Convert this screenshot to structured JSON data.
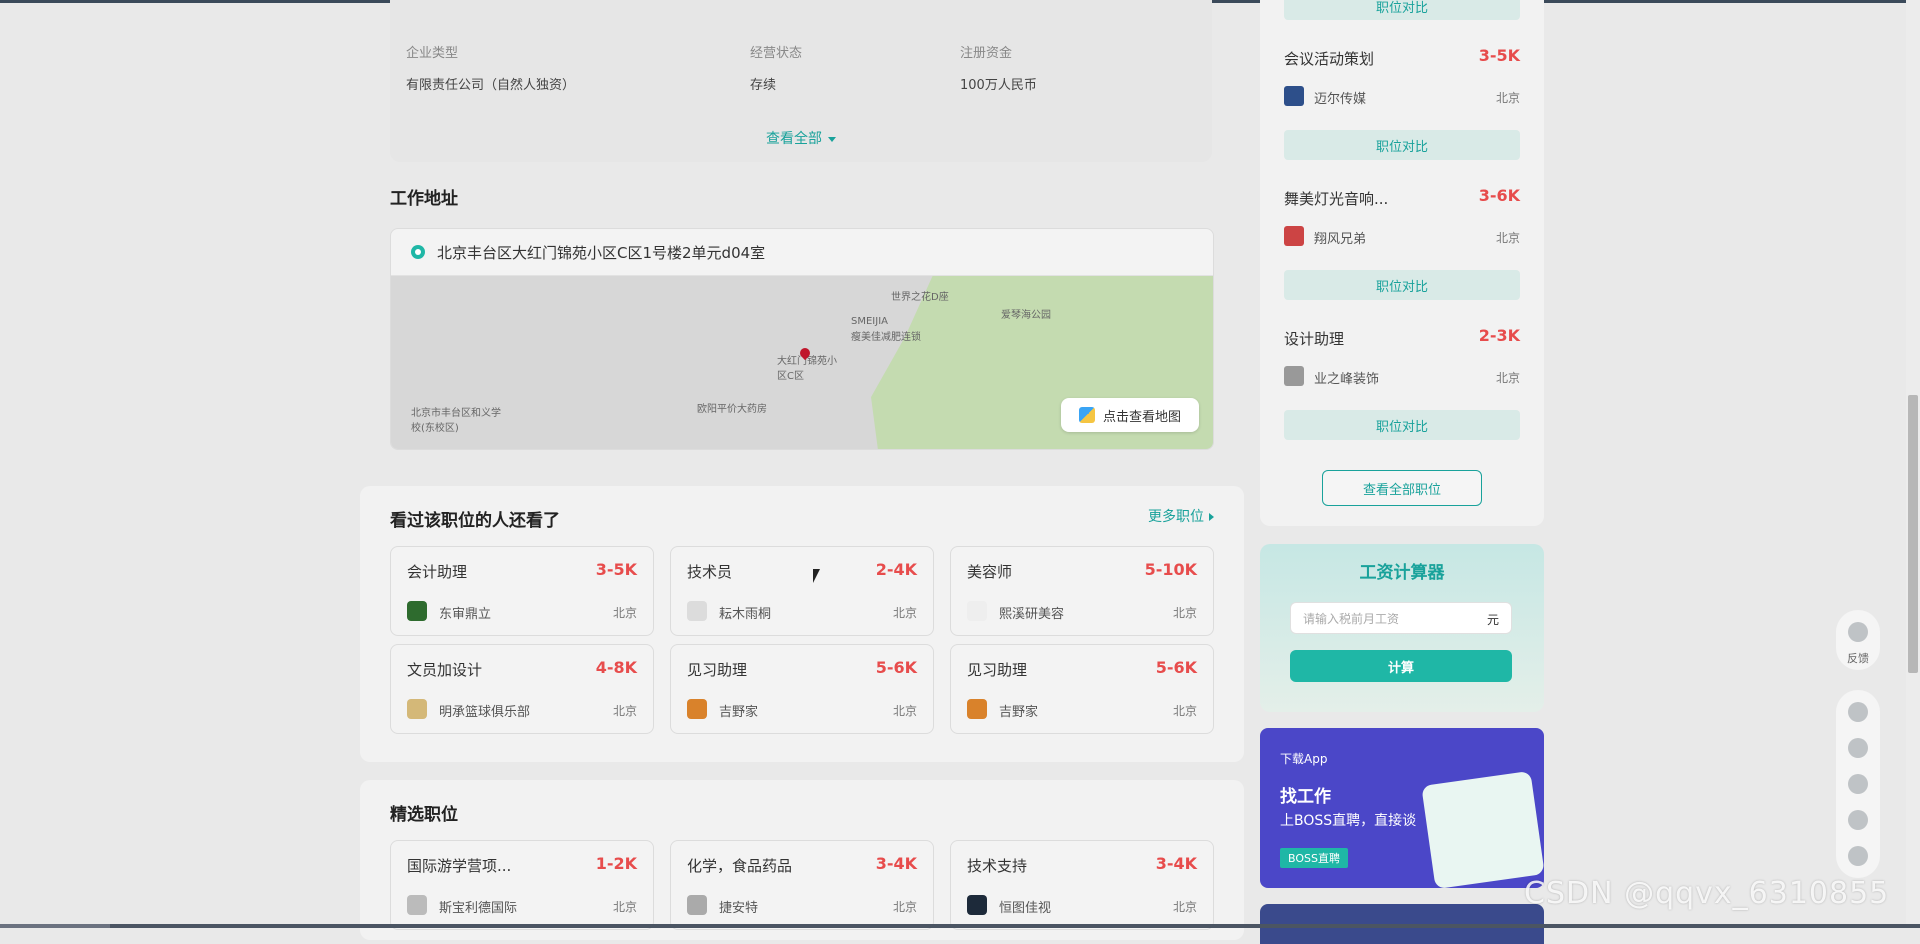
{
  "company": {
    "type_label": "企业类型",
    "type_value": "有限责任公司（自然人独资）",
    "status_label": "经营状态",
    "status_value": "存续",
    "capital_label": "注册资金",
    "capital_value": "100万人民币",
    "view_all": "查看全部"
  },
  "address": {
    "title": "工作地址",
    "text": "北京丰台区大红门锦苑小区C区1号楼2单元d04室",
    "map_button": "点击查看地图",
    "map_labels": [
      "世界之花D座",
      "爱琴海公园",
      "SMEIJIA",
      "瘦美佳减肥连锁",
      "大红门锦苑小区C区",
      "欧阳平价大药房",
      "北京市丰台区和义学校(东校区)"
    ]
  },
  "viewed": {
    "title": "看过该职位的人还看了",
    "more": "更多职位",
    "jobs": [
      {
        "title": "会计助理",
        "salary": "3-5K",
        "company": "东审鼎立",
        "city": "北京"
      },
      {
        "title": "技术员",
        "salary": "2-4K",
        "company": "耘木雨桐",
        "city": "北京"
      },
      {
        "title": "美容师",
        "salary": "5-10K",
        "company": "熙溪研美容",
        "city": "北京"
      },
      {
        "title": "文员加设计",
        "salary": "4-8K",
        "company": "明承篮球俱乐部",
        "city": "北京"
      },
      {
        "title": "见习助理",
        "salary": "5-6K",
        "company": "吉野家",
        "city": "北京"
      },
      {
        "title": "见习助理",
        "salary": "5-6K",
        "company": "吉野家",
        "city": "北京"
      }
    ]
  },
  "featured": {
    "title": "精选职位",
    "jobs": [
      {
        "title": "国际游学营项...",
        "salary": "1-2K",
        "company": "斯宝利德国际",
        "city": "北京"
      },
      {
        "title": "化学，食品药品",
        "salary": "3-4K",
        "company": "捷安特",
        "city": "北京"
      },
      {
        "title": "技术支持",
        "salary": "3-4K",
        "company": "恒图佳视",
        "city": "北京"
      }
    ]
  },
  "sidebar": {
    "compare_label": "职位对比",
    "jobs": [
      {
        "title": "会议活动策划",
        "salary": "3-5K",
        "company": "迈尔传媒",
        "city": "北京"
      },
      {
        "title": "舞美灯光音响...",
        "salary": "3-6K",
        "company": "翔风兄弟",
        "city": "北京"
      },
      {
        "title": "设计助理",
        "salary": "2-3K",
        "company": "业之峰装饰",
        "city": "北京"
      }
    ],
    "all_jobs": "查看全部职位"
  },
  "calculator": {
    "title": "工资计算器",
    "placeholder": "请输入税前月工资",
    "unit": "元",
    "button": "计算"
  },
  "app_banner": {
    "download": "下载App",
    "headline": "找工作",
    "slogan": "上BOSS直聘，直接谈",
    "badge": "BOSS直聘"
  },
  "toolbar": {
    "feedback": "反馈"
  },
  "watermark": "CSDN @qqvx_6310855"
}
